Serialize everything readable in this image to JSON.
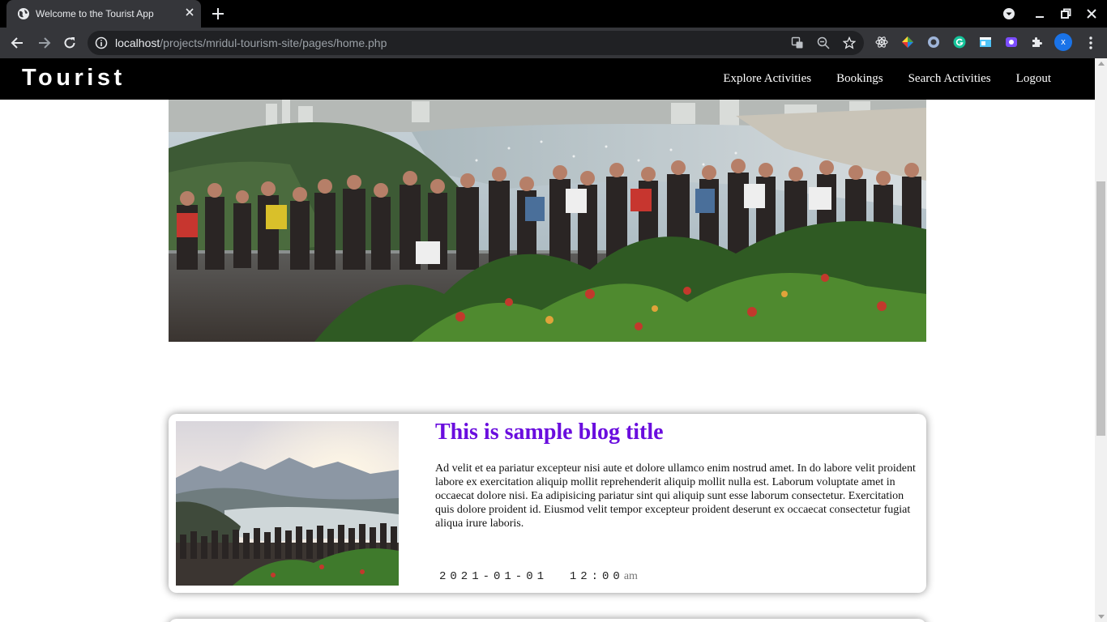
{
  "browser": {
    "tab_title": "Welcome to the Tourist App",
    "url_host": "localhost",
    "url_path": "/projects/mridul-tourism-site/pages/home.php",
    "profile_initial": "x"
  },
  "site": {
    "brand": "Tourist",
    "nav": [
      "Explore Activities",
      "Bookings",
      "Search Activities",
      "Logout"
    ]
  },
  "blog": {
    "title": "This is sample blog title",
    "body": "Ad velit et ea pariatur excepteur nisi aute et dolore ullamco enim nostrud amet. In do labore velit proident labore ex exercitation aliquip mollit reprehenderit aliquip mollit nulla est. Laborum voluptate amet in occaecat dolore nisi. Ea adipisicing pariatur sint qui aliquip sunt esse laborum consectetur. Exercitation quis dolore proident id. Eiusmod velit tempor excepteur proident deserunt ex occaecat consectetur fugiat aliqua irure laboris.",
    "date": "2021-01-01",
    "time": "12:00",
    "ampm": "am"
  },
  "colors": {
    "accent": "#6a0dde",
    "nav_bg": "#000000"
  }
}
